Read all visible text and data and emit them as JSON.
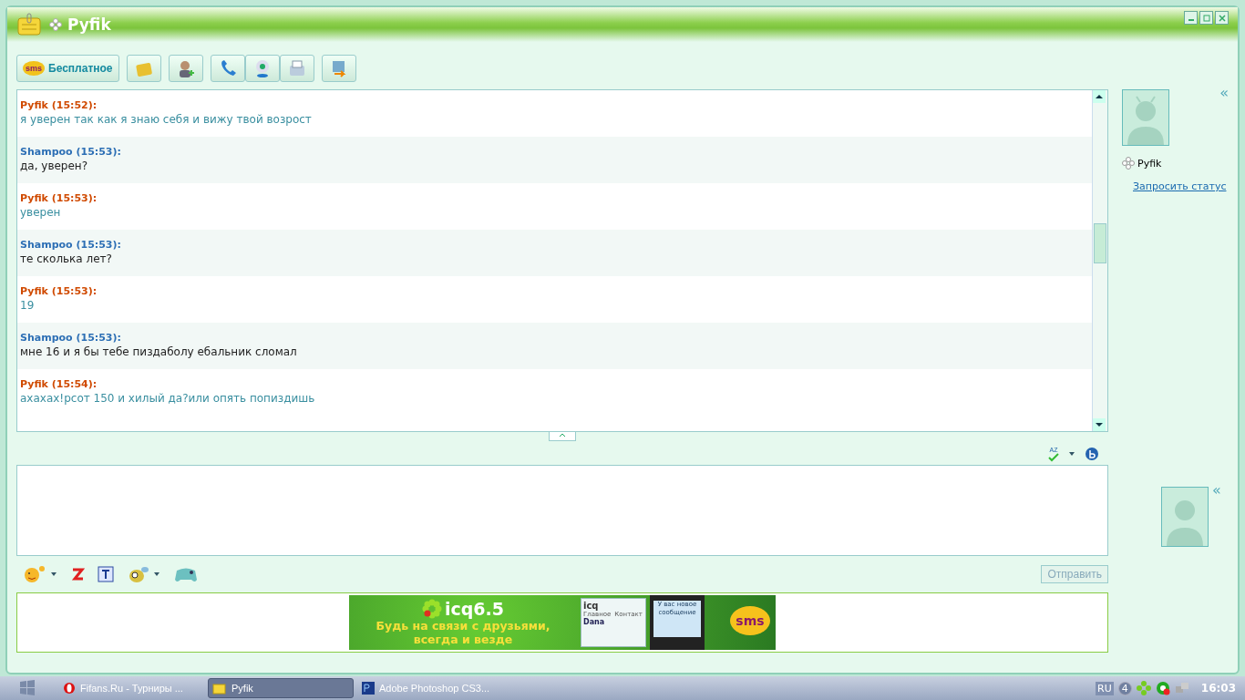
{
  "window": {
    "title": "Pyfik"
  },
  "toolbar": {
    "sms_logo": "sms",
    "sms_label": "Бесплатное"
  },
  "spellcheck": "AZ",
  "collapse_top": "«",
  "collapse_bottom": "«",
  "messages": [
    {
      "header": "Pyfik (15:52):",
      "text": "я уверен так как я знаю себя и вижу твой возрост",
      "kind": "contact"
    },
    {
      "header": "Shampoo (15:53):",
      "text": "да, уверен?",
      "kind": "self"
    },
    {
      "header": "Pyfik (15:53):",
      "text": "уверен",
      "kind": "contact"
    },
    {
      "header": "Shampoo (15:53):",
      "text": "те сколька лет?",
      "kind": "self"
    },
    {
      "header": "Pyfik (15:53):",
      "text": "19",
      "kind": "contact"
    },
    {
      "header": "Shampoo (15:53):",
      "text": "мне 16 и я бы тебе пиздаболу ебальник сломал",
      "kind": "self"
    },
    {
      "header": "Pyfik (15:54):",
      "text": "ахахах!рсот 150 и хилый да?или опять попиздишь",
      "kind": "contact"
    }
  ],
  "contact": {
    "name": "Pyfik",
    "request_status": "Запросить статус"
  },
  "send_button": "Отправить",
  "ad": {
    "brand": "icq6.5",
    "slogan_1": "Будь на связи с друзьями,",
    "slogan_2": "всегда и везде",
    "mini_logo": "icq",
    "mini_tab_1": "Главное",
    "mini_tab_2": "Контакт",
    "mini_contact": "Dana",
    "phone_text": "У вас новое сообщение",
    "bubble": "sms"
  },
  "taskbar": {
    "items": [
      {
        "label": "Fifans.Ru - Турниры ...",
        "kind": "browser",
        "selected": false
      },
      {
        "label": "Pyfik",
        "kind": "icq",
        "selected": true
      },
      {
        "label": "Adobe Photoshop CS3...",
        "kind": "ps",
        "selected": false
      }
    ],
    "lang": "RU",
    "tray_count": "4",
    "clock": "16:03"
  }
}
